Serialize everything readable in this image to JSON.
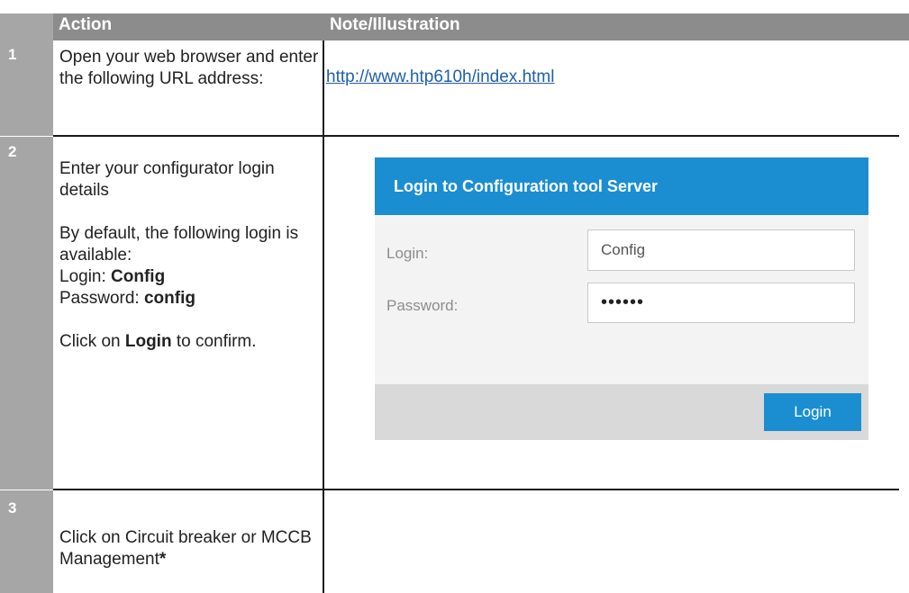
{
  "table": {
    "header": {
      "number": "",
      "action": "Action",
      "note": "Note/Illustration"
    },
    "rows": [
      {
        "number": "1",
        "action": "Open your web browser and enter the following URL address:",
        "url": "http://www.htp610h/index.html"
      },
      {
        "number": "2",
        "action_intro": "Enter your configurator login details",
        "action_default": "By default, the following login is available:",
        "login_label": "Login: ",
        "login_value": "Config",
        "password_label": "Password: ",
        "password_value": "config",
        "click_prefix": "Click on ",
        "click_bold": "Login",
        "click_suffix": " to confirm.",
        "illustration": {
          "title": "Login to Configuration tool Server",
          "login_label": "Login:",
          "login_value": "Config",
          "password_label": "Password:",
          "password_mask": "••••••",
          "button": "Login",
          "header_color": "#1b8ed1"
        }
      },
      {
        "number": "3",
        "action": "Click on Circuit breaker or MCCB Management",
        "asterisk": "*"
      }
    ]
  }
}
